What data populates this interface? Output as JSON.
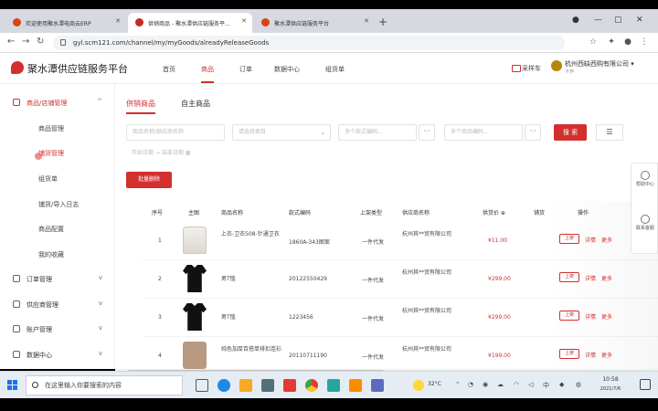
{
  "browser": {
    "tabs": [
      {
        "label": "欢迎使用聚水潭电商云ERP"
      },
      {
        "label": "供销商品 - 聚水潭供应链服务平..."
      },
      {
        "label": "聚水潭供应链服务平台"
      }
    ],
    "new_tab": "+",
    "url": "gyl.scm121.com/channel/my/myGoods/alreadyReleaseGoods"
  },
  "header": {
    "brand": "聚水潭供应链服务平台",
    "nav": [
      "首页",
      "商品",
      "订单",
      "数据中心",
      "组货单"
    ],
    "active_nav_index": 1,
    "cart": "采样车",
    "company": "杭州西缺西购有限公司",
    "company_caret": "▾",
    "role": "卡伊"
  },
  "sidebar": {
    "groups": [
      {
        "label": "商品/店铺管理",
        "chevron": "^",
        "active": true
      },
      {
        "label": "订单管理",
        "chevron": "v"
      },
      {
        "label": "供应商管理",
        "chevron": "v"
      },
      {
        "label": "账户管理",
        "chevron": "v"
      },
      {
        "label": "数据中心",
        "chevron": "v"
      }
    ],
    "items": [
      "商品管理",
      "铺货管理",
      "组货单",
      "铺货/导入日志",
      "商品配置",
      "我的收藏"
    ],
    "active_item_index": 1
  },
  "main": {
    "subtabs": [
      "供销商品",
      "自主商品"
    ],
    "filters": {
      "name": "商品名称/供应商名称",
      "category": "请选择类目",
      "style_code": "多个款式编码...",
      "product_code": "多个商品编码...",
      "more": "···",
      "date_range": "开始日期 → 结束日期"
    },
    "search_button": "搜 索",
    "view_toggle": "☰",
    "batch_delete": "批量删除",
    "columns": [
      "序号",
      "主图",
      "商品名称",
      "款式编码",
      "上架类型",
      "供应商名称",
      "供货价 ⊕",
      "铺货",
      "操作"
    ],
    "rows": [
      {
        "index": "1",
        "image": "jacket",
        "name": "上衣-卫衣508-针通卫衣",
        "code": "1860A-343图案",
        "type": "一件代发",
        "supplier": "杭州其**贸有限公司",
        "price": "¥11.00",
        "action": "上架",
        "detail": "详情",
        "more": "更多"
      },
      {
        "index": "2",
        "image": "tee",
        "name": "男T恤",
        "code": "20122550429",
        "type": "一件代发",
        "supplier": "杭州其**贸有限公司",
        "price": "¥299.00",
        "action": "上架",
        "detail": "详情",
        "more": "更多"
      },
      {
        "index": "3",
        "image": "tee",
        "name": "男T恤",
        "code": "1223456",
        "type": "一件代发",
        "supplier": "杭州其**贸有限公司",
        "price": "¥299.00",
        "action": "上架",
        "detail": "详情",
        "more": "更多"
      },
      {
        "index": "4",
        "image": "coat",
        "name": "纯色加厚百搭单排扣连衫",
        "code": "20110711190",
        "type": "一件代发",
        "supplier": "杭州其**贸有限公司",
        "price": "¥199.00",
        "action": "上架",
        "detail": "详情",
        "more": "更多"
      }
    ]
  },
  "float_panel": [
    {
      "label": "帮助中心",
      "icon": "help-icon"
    },
    {
      "label": "联系客服",
      "icon": "headset-icon"
    }
  ],
  "taskbar": {
    "search_placeholder": "在这里输入你要搜索的内容",
    "weather": "32°C",
    "time": "10:58",
    "date": "2021/7/6",
    "accent": "#1a73e8"
  },
  "colors": {
    "brand_red": "#d32f2f"
  }
}
